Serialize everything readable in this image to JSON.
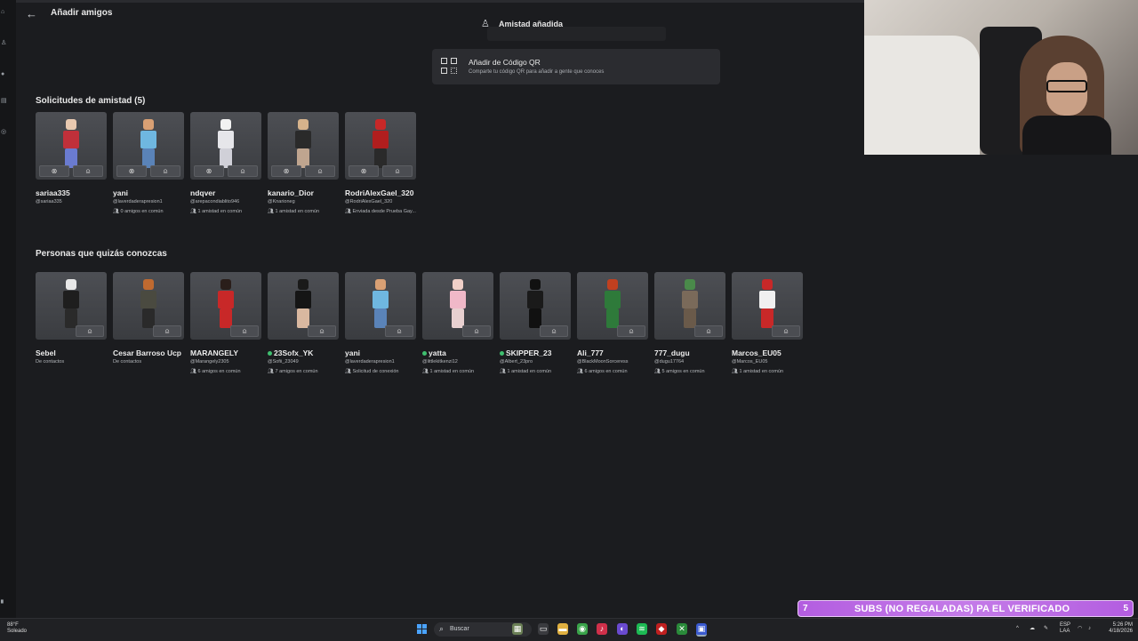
{
  "header": {
    "back_icon": "arrow-left-icon",
    "title": "Añadir amigos"
  },
  "toast": {
    "text": "Amistad añadida"
  },
  "qr": {
    "title": "Añadir de Código QR",
    "subtitle": "Comparte tu código QR para añadir a gente que conoces"
  },
  "requests": {
    "title": "Solicitudes de amistad (5)",
    "items": [
      {
        "name": "sariaa335",
        "handle": "@sariaa335",
        "mutual": "",
        "colors": [
          "#e8c9b0",
          "#c0303a",
          "#6a7bd0"
        ]
      },
      {
        "name": "yani",
        "handle": "@laverdaderapresion1",
        "mutual": "0 amigos en común",
        "colors": [
          "#d9a074",
          "#6fb7e0",
          "#5a83b8"
        ]
      },
      {
        "name": "ndqver",
        "handle": "@arepacondiablito946",
        "mutual": "1 amistad en común",
        "colors": [
          "#f2f2f2",
          "#e6e6ea",
          "#d0d0d8"
        ]
      },
      {
        "name": "kanario_Dior",
        "handle": "@Knarioneg",
        "mutual": "1 amistad en común",
        "colors": [
          "#d6b38c",
          "#2a2a2a",
          "#bfa58f"
        ]
      },
      {
        "name": "RodriAlexGael_320",
        "handle": "@RodriAlexGael_320",
        "mutual": "Enviada desde Prueba Gay...",
        "colors": [
          "#c82828",
          "#b01e1e",
          "#2a2a2a"
        ]
      }
    ]
  },
  "suggestions": {
    "title": "Personas que quizás conozcas",
    "items": [
      {
        "name": "Sebel",
        "handle": "De contactos",
        "mutual": "",
        "online": false,
        "colors": [
          "#e8e8e8",
          "#1e1e1e",
          "#2a2a2a"
        ]
      },
      {
        "name": "Cesar Barroso Ucp",
        "handle": "De contactos",
        "mutual": "",
        "online": false,
        "colors": [
          "#c06a30",
          "#4a4a40",
          "#2a2a2a"
        ]
      },
      {
        "name": "MARANGELY",
        "handle": "@Marangely2305",
        "mutual": "6 amigos en común",
        "online": false,
        "colors": [
          "#2a1e1a",
          "#c82828",
          "#c82828"
        ]
      },
      {
        "name": "23Sofx_YK",
        "handle": "@Sofii_23049",
        "mutual": "7 amigos en común",
        "online": true,
        "colors": [
          "#1a1a1a",
          "#151515",
          "#d9b8a0"
        ]
      },
      {
        "name": "yani",
        "handle": "@laverdaderapresion1",
        "mutual": "Solicitud de conexión",
        "online": false,
        "colors": [
          "#d9a074",
          "#6fb7e0",
          "#5a83b8"
        ]
      },
      {
        "name": "yatta",
        "handle": "@littlekitkenzi12",
        "mutual": "1 amistad en común",
        "online": true,
        "colors": [
          "#f0d0c8",
          "#f0b8c8",
          "#e8d0d0"
        ]
      },
      {
        "name": "SKIPPER_23",
        "handle": "@Albert_23pro",
        "mutual": "1 amistad en común",
        "online": true,
        "colors": [
          "#111111",
          "#1a1a1a",
          "#111111"
        ]
      },
      {
        "name": "Ali_777",
        "handle": "@BlackMoonSorceress",
        "mutual": "6 amigos en común",
        "online": false,
        "colors": [
          "#c04020",
          "#2e7a3a",
          "#2e7a3a"
        ]
      },
      {
        "name": "777_dugu",
        "handle": "@dugu17764",
        "mutual": "5 amigos en común",
        "online": false,
        "colors": [
          "#4a8a4a",
          "#7a6a5a",
          "#6a5a4a"
        ]
      },
      {
        "name": "Marcos_EU05",
        "handle": "@Marcos_EU05",
        "mutual": "1 amistad en común",
        "online": false,
        "colors": [
          "#c82828",
          "#f0f0f0",
          "#c82828"
        ]
      }
    ]
  },
  "subs_banner": {
    "left": "7",
    "text": "SUBS (NO REGALADAS) PA EL VERIFICADO",
    "right": "5"
  },
  "taskbar": {
    "weather_temp": "88°F",
    "weather_desc": "Soleado",
    "search_placeholder": "Buscar",
    "lang": "ESP",
    "lang2": "LAA",
    "time": "5:26 PM",
    "date": "4/18/2026"
  }
}
